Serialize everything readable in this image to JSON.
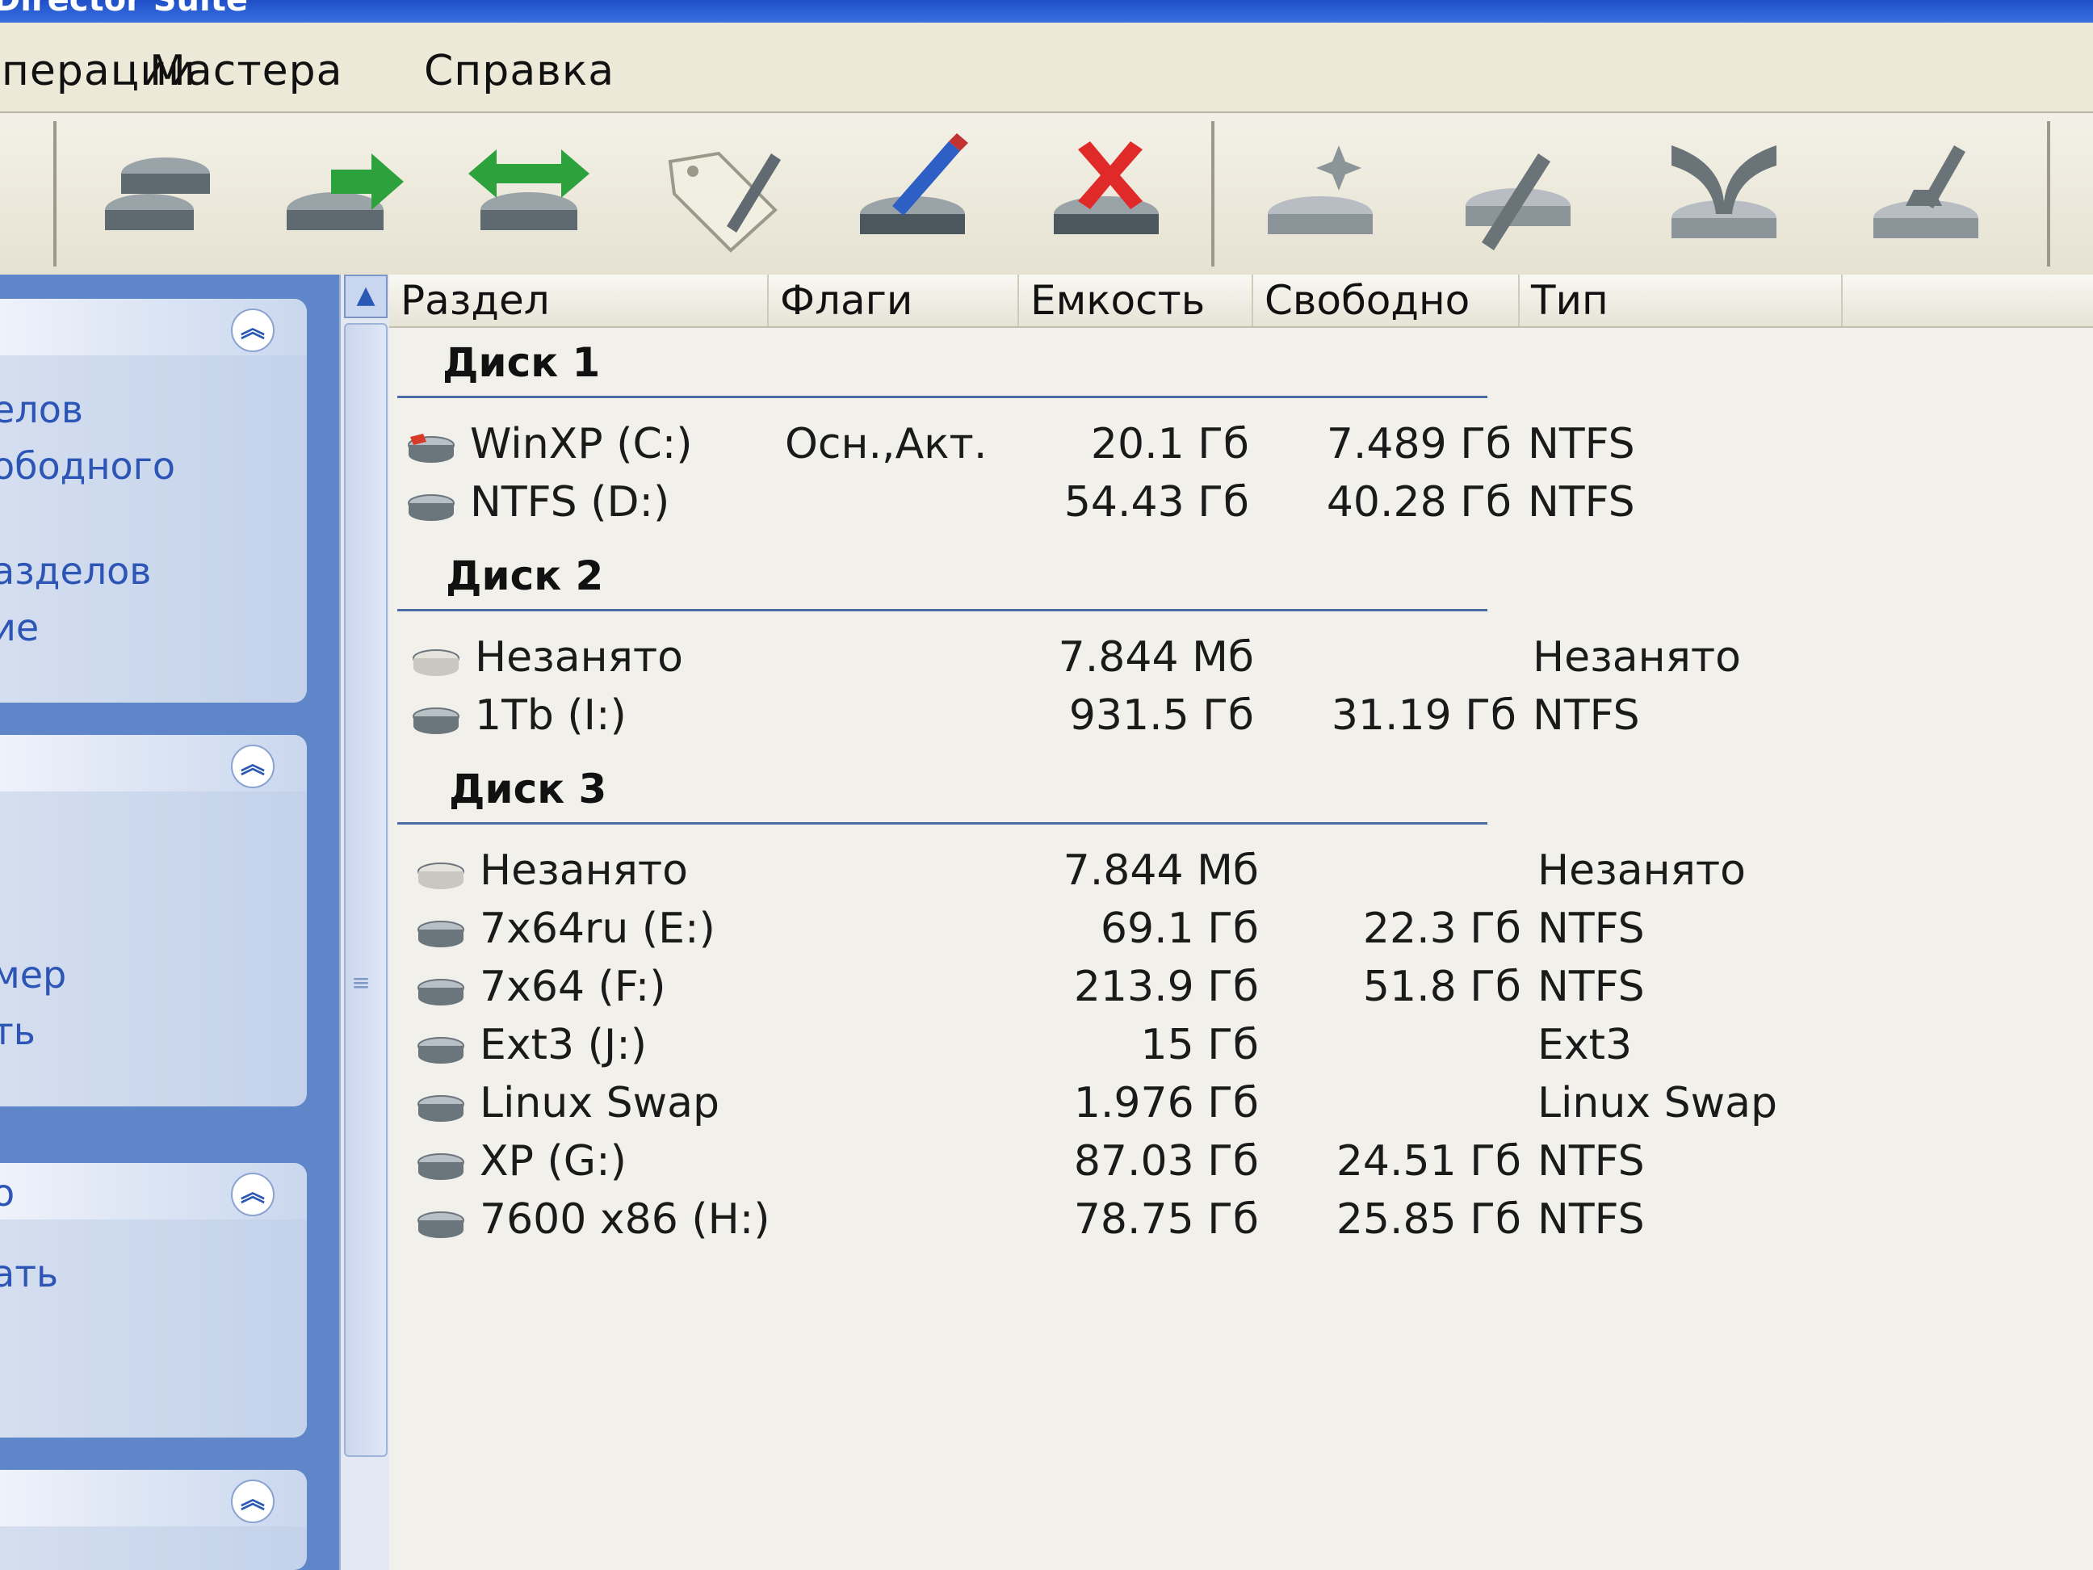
{
  "window": {
    "title": "Director Suite"
  },
  "menu": [
    {
      "label": "Операции"
    },
    {
      "label": "Мастера"
    },
    {
      "label": "Справка"
    }
  ],
  "toolbar": {
    "buttons": [
      {
        "icon": "disks-icon"
      },
      {
        "icon": "move-disk-icon"
      },
      {
        "icon": "resize-disk-icon"
      },
      {
        "icon": "label-icon"
      },
      {
        "icon": "edit-disk-icon"
      },
      {
        "icon": "delete-disk-icon"
      },
      {
        "icon": "disk-wizard-icon"
      },
      {
        "icon": "split-disk-icon"
      },
      {
        "icon": "merge-disk-icon"
      },
      {
        "icon": "clean-disk-icon"
      }
    ]
  },
  "tasks": {
    "box1": [
      "елов",
      "ободного",
      "азделов",
      "ие"
    ],
    "box2": [
      "мер",
      "ть"
    ],
    "box3": [
      "о",
      "ать"
    ]
  },
  "columns": {
    "partition": "Раздел",
    "flags": "Флаги",
    "capacity": "Емкость",
    "free": "Свободно",
    "type": "Тип"
  },
  "disks": [
    {
      "title": "Диск 1",
      "rows": [
        {
          "name": "WinXP (C:)",
          "flags": "Осн.,Акт.",
          "capacity": "20.1 Гб",
          "free": "7.489 Гб",
          "type": "NTFS",
          "active": true
        },
        {
          "name": "NTFS (D:)",
          "flags": "",
          "capacity": "54.43 Гб",
          "free": "40.28 Гб",
          "type": "NTFS"
        }
      ]
    },
    {
      "title": "Диск 2",
      "rows": [
        {
          "name": "Незанято",
          "flags": "",
          "capacity": "7.844 Мб",
          "free": "",
          "type": "Незанято",
          "unallocated": true
        },
        {
          "name": "1Tb (I:)",
          "flags": "",
          "capacity": "931.5 Гб",
          "free": "31.19 Гб",
          "type": "NTFS"
        }
      ]
    },
    {
      "title": "Диск 3",
      "rows": [
        {
          "name": "Незанято",
          "flags": "",
          "capacity": "7.844 Мб",
          "free": "",
          "type": "Незанято",
          "unallocated": true
        },
        {
          "name": "7x64ru (E:)",
          "flags": "",
          "capacity": "69.1 Гб",
          "free": "22.3 Гб",
          "type": "NTFS"
        },
        {
          "name": "7x64 (F:)",
          "flags": "",
          "capacity": "213.9 Гб",
          "free": "51.8 Гб",
          "type": "NTFS"
        },
        {
          "name": "Ext3 (J:)",
          "flags": "",
          "capacity": "15 Гб",
          "free": "",
          "type": "Ext3"
        },
        {
          "name": "Linux Swap",
          "flags": "",
          "capacity": "1.976 Гб",
          "free": "",
          "type": "Linux Swap"
        },
        {
          "name": "XP (G:)",
          "flags": "",
          "capacity": "87.03 Гб",
          "free": "24.51 Гб",
          "type": "NTFS"
        },
        {
          "name": "7600 x86 (H:)",
          "flags": "",
          "capacity": "78.75 Гб",
          "free": "25.85 Гб",
          "type": "NTFS"
        }
      ]
    }
  ]
}
